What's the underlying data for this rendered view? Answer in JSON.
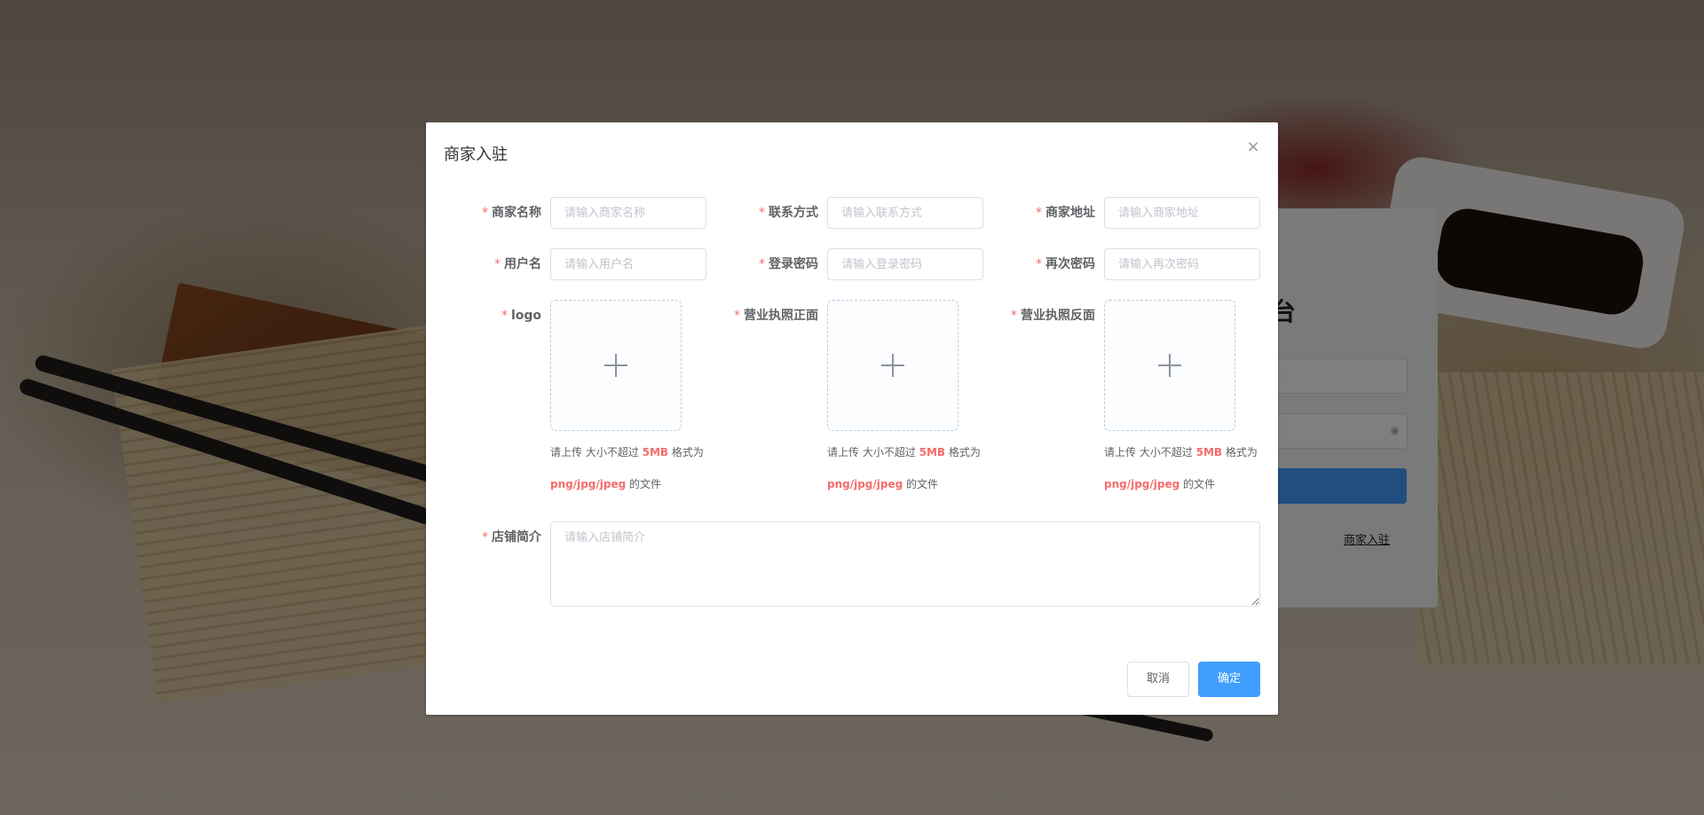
{
  "login": {
    "title_partial": "台",
    "merchant_link": "商家入驻"
  },
  "dialog": {
    "title": "商家入驻",
    "close_icon": "×",
    "fields": {
      "shop_name": {
        "label": "商家名称",
        "placeholder": "请输入商家名称"
      },
      "contact": {
        "label": "联系方式",
        "placeholder": "请输入联系方式"
      },
      "address": {
        "label": "商家地址",
        "placeholder": "请输入商家地址"
      },
      "username": {
        "label": "用户名",
        "placeholder": "请输入用户名"
      },
      "password": {
        "label": "登录密码",
        "placeholder": "请输入登录密码"
      },
      "password_again": {
        "label": "再次密码",
        "placeholder": "请输入再次密码"
      },
      "logo": {
        "label": "logo"
      },
      "license_front": {
        "label": "营业执照正面"
      },
      "license_back": {
        "label": "营业执照反面"
      },
      "intro": {
        "label": "店铺简介",
        "placeholder": "请输入店铺简介"
      }
    },
    "upload_tip": {
      "prefix": "请上传 大小不超过 ",
      "size": "5MB",
      "middle": " 格式为",
      "formats": "png/jpg/jpeg",
      "suffix": " 的文件"
    },
    "required_mark": "*",
    "buttons": {
      "cancel": "取消",
      "confirm": "确定"
    }
  },
  "colors": {
    "primary": "#409eff",
    "danger": "#f56c6c",
    "text": "#606266",
    "border": "#dcdfe6"
  }
}
